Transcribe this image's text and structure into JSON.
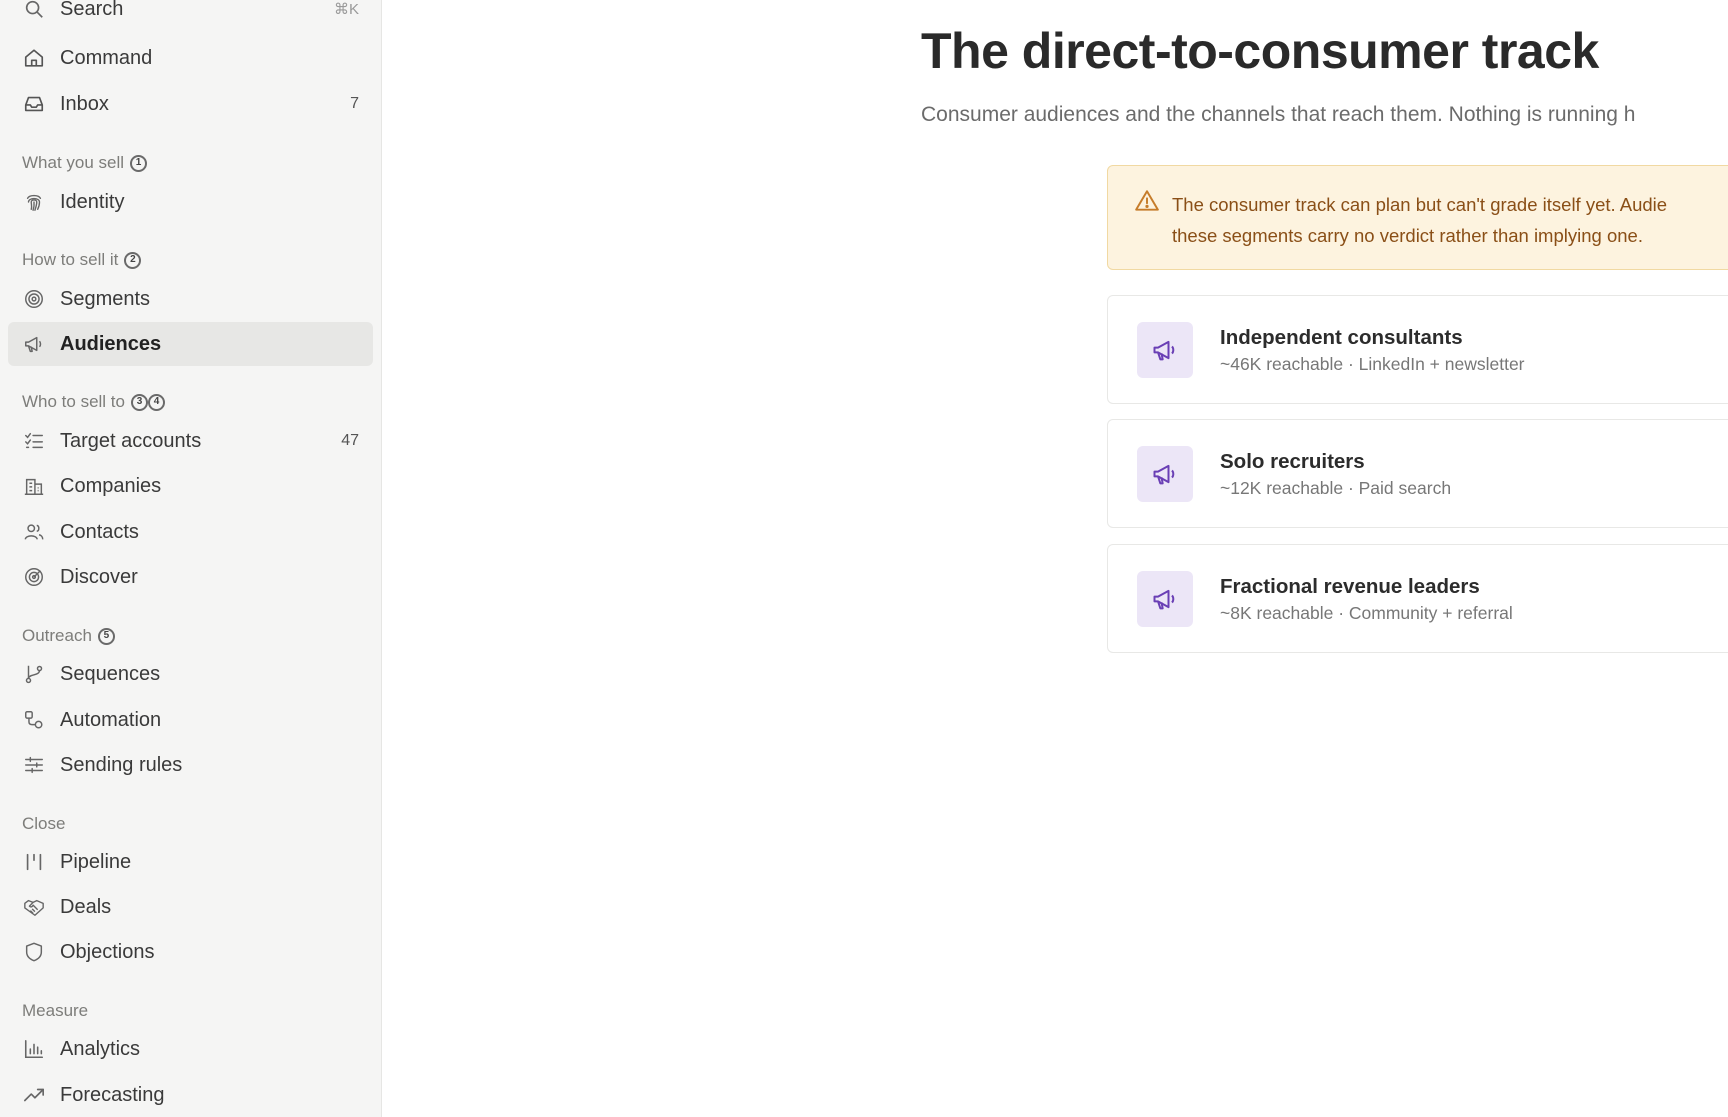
{
  "sidebar": {
    "search": {
      "label": "Search",
      "shortcut": "⌘K"
    },
    "top": [
      {
        "label": "Command",
        "icon": "home-icon"
      },
      {
        "label": "Inbox",
        "icon": "inbox-icon",
        "count": "7"
      }
    ],
    "sections": {
      "what_you_sell": {
        "title": "What you sell",
        "badge": "1"
      },
      "how_to_sell_it": {
        "title": "How to sell it",
        "badge": "2"
      },
      "who_to_sell_to": {
        "title": "Who to sell to",
        "badges": [
          "3",
          "4"
        ]
      },
      "outreach": {
        "title": "Outreach",
        "badge": "5"
      },
      "close": {
        "title": "Close"
      },
      "measure": {
        "title": "Measure"
      }
    },
    "items": {
      "identity": "Identity",
      "segments": "Segments",
      "audiences": "Audiences",
      "target_accounts": "Target accounts",
      "target_accounts_count": "47",
      "companies": "Companies",
      "contacts": "Contacts",
      "discover": "Discover",
      "sequences": "Sequences",
      "automation": "Automation",
      "sending_rules": "Sending rules",
      "pipeline": "Pipeline",
      "deals": "Deals",
      "objections": "Objections",
      "analytics": "Analytics",
      "forecasting": "Forecasting"
    },
    "active_item": "Audiences"
  },
  "main": {
    "title": "The direct-to-consumer track",
    "subtitle": "Consumer audiences and the channels that reach them. Nothing is running h",
    "warning": {
      "icon": "warning-triangle-icon",
      "line1": "The consumer track can plan but can't grade itself yet. Audie",
      "line2": "these segments carry no verdict rather than implying one."
    },
    "audiences": [
      {
        "name": "Independent consultants",
        "meta": "~46K reachable · LinkedIn + newsletter",
        "icon": "megaphone-icon"
      },
      {
        "name": "Solo recruiters",
        "meta": "~12K reachable · Paid search",
        "icon": "megaphone-icon"
      },
      {
        "name": "Fractional revenue leaders",
        "meta": "~8K reachable · Community + referral",
        "icon": "megaphone-icon"
      }
    ]
  },
  "colors": {
    "sidebar_bg": "#f5f5f4",
    "active_bg": "#e7e7e5",
    "warning_bg": "#fdf3df",
    "warning_border": "#f1d9a2",
    "warning_text": "#8a4f17",
    "accent_purple": "#6a3fb5",
    "icon_tile_bg": "#ece6f7"
  }
}
